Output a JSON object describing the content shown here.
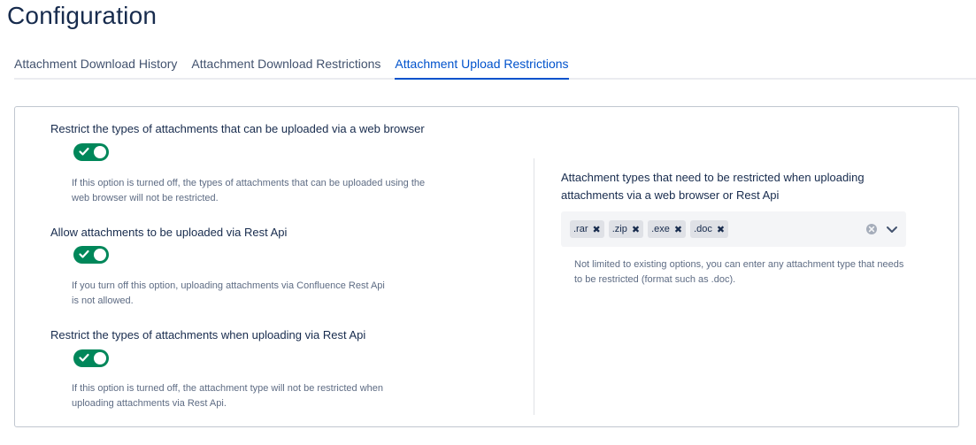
{
  "page": {
    "title": "Configuration"
  },
  "tabs": [
    {
      "label": "Attachment Download History"
    },
    {
      "label": "Attachment Download Restrictions"
    },
    {
      "label": "Attachment Upload Restrictions",
      "active": true
    }
  ],
  "options": [
    {
      "label": "Restrict the types of attachments that can be uploaded via a web browser",
      "enabled": true,
      "help_line1": "If this option is turned off, the types of attachments that can be uploaded using the",
      "help_line2": "web browser will not be restricted."
    },
    {
      "label": "Allow attachments to be uploaded via Rest Api",
      "enabled": true,
      "help_line1": "If you turn off this option, uploading attachments via Confluence Rest Api",
      "help_line2": "is not allowed."
    },
    {
      "label": "Restrict the types of attachments when uploading via Rest Api",
      "enabled": true,
      "help_line1": "If this option is turned off, the attachment type will not be restricted when",
      "help_line2": "uploading attachments via Rest Api."
    }
  ],
  "restricted_types": {
    "label": "Attachment types that need to be restricted when uploading attachments via a web browser or Rest Api",
    "tags": [
      ".rar",
      ".zip",
      ".exe",
      ".doc"
    ],
    "remove_glyph": "✖",
    "help": "Not limited to existing options, you can enter any attachment type that needs to be restricted (format such as .doc)."
  },
  "colors": {
    "accent": "#0052cc",
    "toggle_on": "#00875a"
  },
  "icons": {
    "toggle_check": "check-icon",
    "tag_remove": "close-icon",
    "clear": "clear-circle-icon",
    "dropdown": "chevron-down-icon"
  }
}
